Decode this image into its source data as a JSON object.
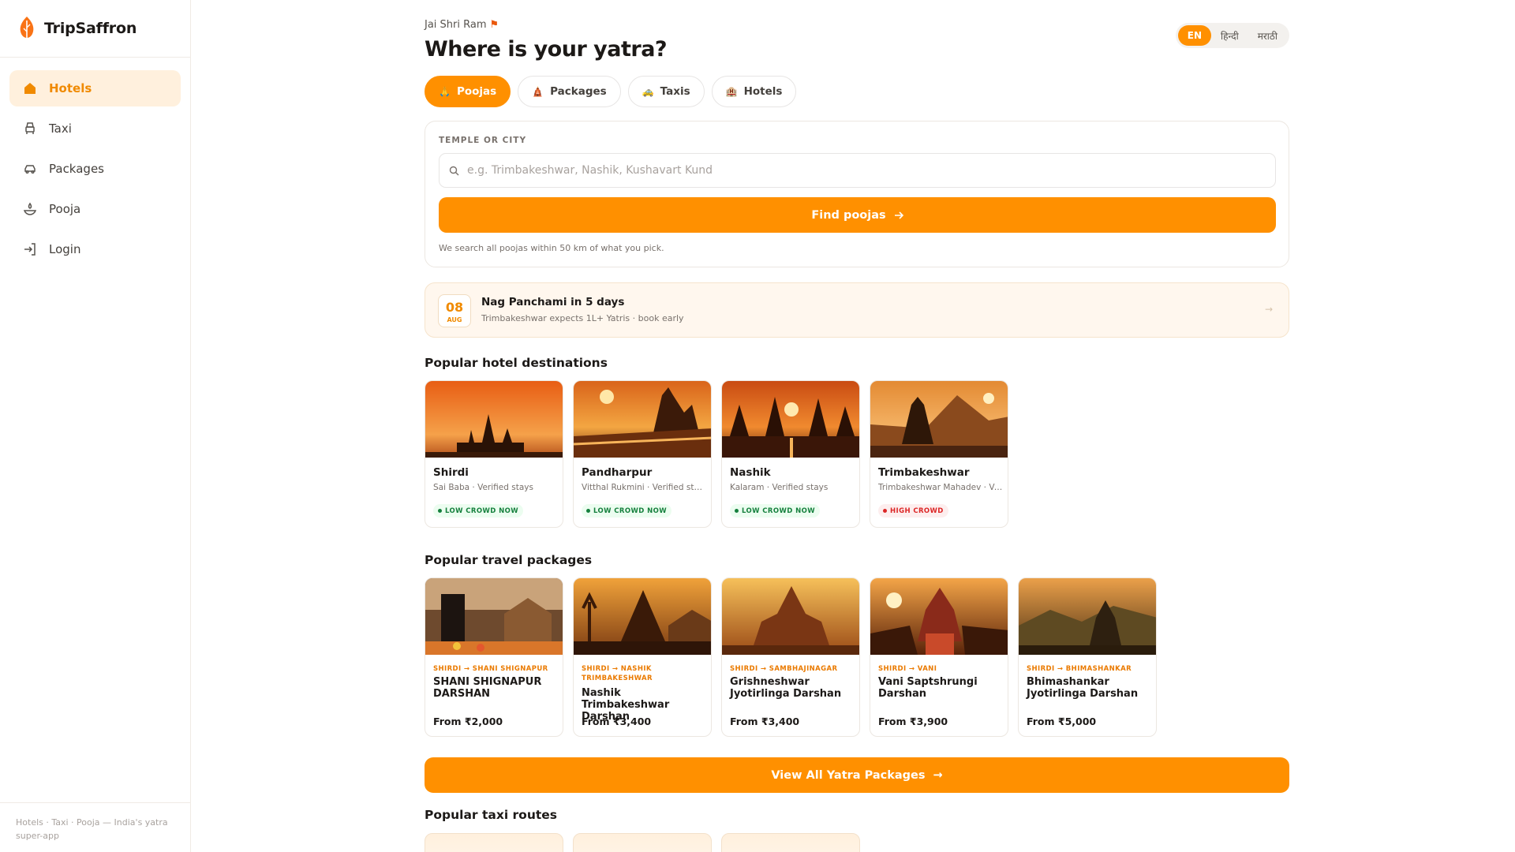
{
  "app": {
    "brand": "TripSaffron"
  },
  "sidebar": {
    "items": [
      {
        "label": "Hotels",
        "icon": "hotel-icon",
        "active": true
      },
      {
        "label": "Taxi",
        "icon": "taxi-icon",
        "active": false
      },
      {
        "label": "Packages",
        "icon": "car-icon",
        "active": false
      },
      {
        "label": "Pooja",
        "icon": "diya-icon",
        "active": false
      },
      {
        "label": "Login",
        "icon": "login-icon",
        "active": false
      }
    ],
    "footer": "Hotels · Taxi · Pooja — India's yatra super-app"
  },
  "header": {
    "greeting": "Jai Shri Ram",
    "greeting_icon": "flag-icon",
    "title": "Where is your yatra?",
    "languages": [
      {
        "label": "EN",
        "selected": true
      },
      {
        "label": "हिन्दी",
        "selected": false
      },
      {
        "label": "मराठी",
        "selected": false
      }
    ]
  },
  "tabs": [
    {
      "label": "Poojas",
      "icon": "🙏",
      "active": true
    },
    {
      "label": "Packages",
      "icon": "🛕",
      "active": false
    },
    {
      "label": "Taxis",
      "icon": "🚕",
      "active": false
    },
    {
      "label": "Hotels",
      "icon": "🏨",
      "active": false
    }
  ],
  "search": {
    "label": "TEMPLE OR CITY",
    "placeholder": "e.g. Trimbakeshwar, Nashik, Kushavart Kund",
    "value": "",
    "button": "Find poojas",
    "hint": "We search all poojas within 50 km of what you pick."
  },
  "festival": {
    "day": "08",
    "month": "AUG",
    "title": "Nag Panchami in 5 days",
    "subtitle": "Trimbakeshwar expects 1L+ Yatris · book early",
    "arrow": "→"
  },
  "hotels": {
    "title": "Popular hotel destinations",
    "items": [
      {
        "name": "Shirdi",
        "sub": "Sai Baba · Verified stays",
        "crowd": "LOW CROWD NOW",
        "level": "low"
      },
      {
        "name": "Pandharpur",
        "sub": "Vitthal Rukmini · Verified stays",
        "crowd": "LOW CROWD NOW",
        "level": "low"
      },
      {
        "name": "Nashik",
        "sub": "Kalaram · Verified stays",
        "crowd": "LOW CROWD NOW",
        "level": "low"
      },
      {
        "name": "Trimbakeshwar",
        "sub": "Trimbakeshwar Mahadev · Verified stays",
        "crowd": "HIGH CROWD",
        "level": "high"
      }
    ]
  },
  "packages": {
    "title": "Popular travel packages",
    "items": [
      {
        "route": "SHIRDI → SHANI SHIGNAPUR",
        "name": "SHANI SHIGNAPUR DARSHAN",
        "price": "From ₹2,000"
      },
      {
        "route": "SHIRDI → NASHIK TRIMBAKESHWAR",
        "name": "Nashik Trimbakeshwar Darshan",
        "price": "From ₹3,400"
      },
      {
        "route": "SHIRDI → SAMBHAJINAGAR",
        "name": "Grishneshwar Jyotirlinga Darshan",
        "price": "From ₹3,400"
      },
      {
        "route": "SHIRDI → VANI",
        "name": "Vani Saptshrungi Darshan",
        "price": "From ₹3,900"
      },
      {
        "route": "SHIRDI → BHIMASHANKAR",
        "name": "Bhimashankar Jyotirlinga Darshan",
        "price": "From ₹5,000"
      }
    ],
    "view_all": "View All Yatra Packages",
    "view_all_arrow": "→"
  },
  "taxi": {
    "title": "Popular taxi routes"
  },
  "colors": {
    "accent": "#ff9000",
    "accent_soft": "#fff0dd",
    "low": "#15803d",
    "high": "#dc2626"
  }
}
